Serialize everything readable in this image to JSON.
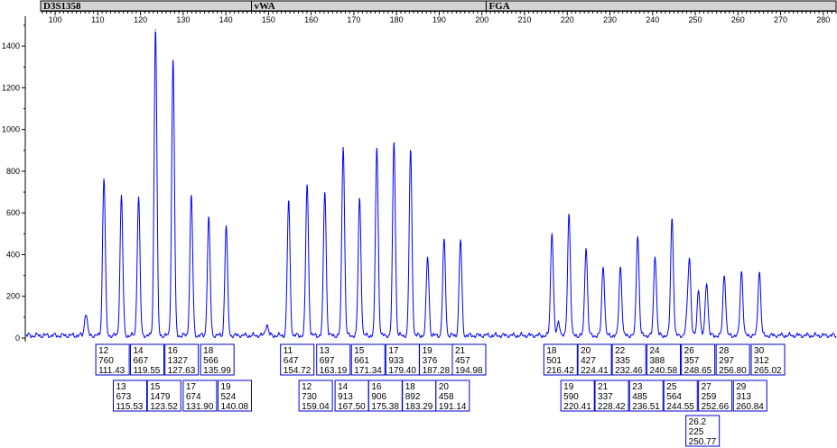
{
  "chart_data": {
    "type": "line",
    "title": "",
    "xlabel": "",
    "ylabel": "",
    "xlim": [
      93,
      283
    ],
    "ylim": [
      0,
      1500
    ],
    "grid": false,
    "x_ticks": [
      100,
      110,
      120,
      130,
      140,
      150,
      160,
      170,
      180,
      190,
      200,
      210,
      220,
      230,
      240,
      250,
      260,
      270,
      280
    ],
    "y_ticks": [
      0,
      200,
      400,
      600,
      800,
      1000,
      1200,
      1400
    ],
    "line_color": "#0000ff",
    "markers": [
      {
        "name": "D3S1358",
        "range": [
          93,
          146
        ]
      },
      {
        "name": "vWA",
        "range": [
          146,
          201
        ]
      },
      {
        "name": "FGA",
        "range": [
          201,
          283
        ]
      }
    ],
    "minor_peaks": [
      {
        "x": 107.2,
        "y": 110
      },
      {
        "x": 149.6,
        "y": 55
      },
      {
        "x": 218.0,
        "y": 65
      },
      {
        "x": 248.1,
        "y": 80
      }
    ],
    "peaks": [
      {
        "allele": "12",
        "height": 760,
        "size": "111.43",
        "x": 111.43,
        "y": 760
      },
      {
        "allele": "13",
        "height": 673,
        "size": "115.53",
        "x": 115.53,
        "y": 673
      },
      {
        "allele": "14",
        "height": 667,
        "size": "119.55",
        "x": 119.55,
        "y": 667
      },
      {
        "allele": "15",
        "height": 1479,
        "size": "123.52",
        "x": 123.52,
        "y": 1479
      },
      {
        "allele": "16",
        "height": 1327,
        "size": "127.63",
        "x": 127.63,
        "y": 1327
      },
      {
        "allele": "17",
        "height": 674,
        "size": "131.90",
        "x": 131.9,
        "y": 674
      },
      {
        "allele": "18",
        "height": 566,
        "size": "135.99",
        "x": 135.99,
        "y": 566
      },
      {
        "allele": "19",
        "height": 524,
        "size": "140.08",
        "x": 140.08,
        "y": 524
      },
      {
        "allele": "11",
        "height": 647,
        "size": "154.72",
        "x": 154.72,
        "y": 647
      },
      {
        "allele": "12",
        "height": 730,
        "size": "159.04",
        "x": 159.04,
        "y": 730
      },
      {
        "allele": "13",
        "height": 697,
        "size": "163.19",
        "x": 163.19,
        "y": 697
      },
      {
        "allele": "14",
        "height": 913,
        "size": "167.50",
        "x": 167.5,
        "y": 913
      },
      {
        "allele": "15",
        "height": 661,
        "size": "171.34",
        "x": 171.34,
        "y": 661
      },
      {
        "allele": "16",
        "height": 906,
        "size": "175.38",
        "x": 175.38,
        "y": 906
      },
      {
        "allele": "17",
        "height": 933,
        "size": "179.40",
        "x": 179.4,
        "y": 933
      },
      {
        "allele": "18",
        "height": 892,
        "size": "183.29",
        "x": 183.29,
        "y": 892
      },
      {
        "allele": "19",
        "height": 376,
        "size": "187.28",
        "x": 187.28,
        "y": 376
      },
      {
        "allele": "20",
        "height": 458,
        "size": "191.14",
        "x": 191.14,
        "y": 458
      },
      {
        "allele": "21",
        "height": 457,
        "size": "194.98",
        "x": 194.98,
        "y": 457
      },
      {
        "allele": "18",
        "height": 501,
        "size": "216.42",
        "x": 216.42,
        "y": 501
      },
      {
        "allele": "19",
        "height": 590,
        "size": "220.41",
        "x": 220.41,
        "y": 590
      },
      {
        "allele": "20",
        "height": 427,
        "size": "224.41",
        "x": 224.41,
        "y": 427
      },
      {
        "allele": "21",
        "height": 337,
        "size": "228.42",
        "x": 228.42,
        "y": 337
      },
      {
        "allele": "22",
        "height": 335,
        "size": "232.46",
        "x": 232.46,
        "y": 335
      },
      {
        "allele": "23",
        "height": 485,
        "size": "236.51",
        "x": 236.51,
        "y": 485
      },
      {
        "allele": "24",
        "height": 388,
        "size": "240.58",
        "x": 240.58,
        "y": 388
      },
      {
        "allele": "25",
        "height": 564,
        "size": "244.55",
        "x": 244.55,
        "y": 564
      },
      {
        "allele": "26",
        "height": 357,
        "size": "248.65",
        "x": 248.65,
        "y": 357
      },
      {
        "allele": "26.2",
        "height": 225,
        "size": "250.77",
        "x": 250.77,
        "y": 225
      },
      {
        "allele": "27",
        "height": 259,
        "size": "252.66",
        "x": 252.66,
        "y": 259
      },
      {
        "allele": "28",
        "height": 297,
        "size": "256.80",
        "x": 256.8,
        "y": 297
      },
      {
        "allele": "29",
        "height": 313,
        "size": "260.84",
        "x": 260.84,
        "y": 313
      },
      {
        "allele": "30",
        "height": 312,
        "size": "265.02",
        "x": 265.02,
        "y": 312
      }
    ]
  }
}
